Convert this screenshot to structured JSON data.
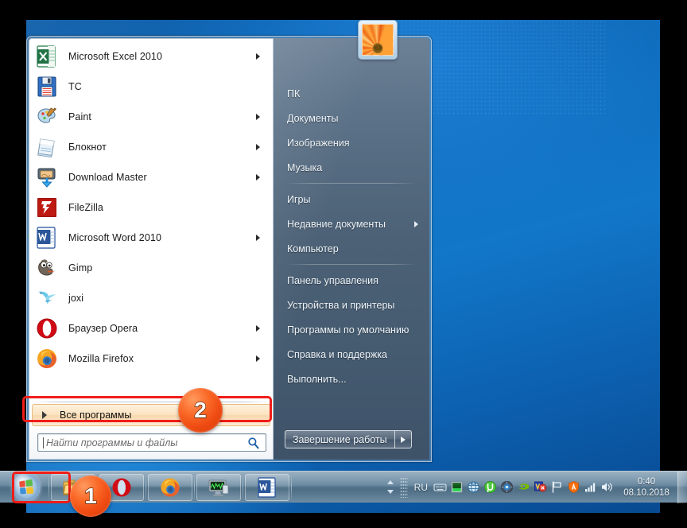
{
  "desktop": {
    "wallpaper_name": "windows-7-blue-wallpaper"
  },
  "start_menu": {
    "avatar_name": "user-avatar-flower",
    "programs": [
      {
        "label": "Microsoft Excel 2010",
        "icon": "excel-icon",
        "has_submenu": true
      },
      {
        "label": "TC",
        "icon": "total-commander-icon",
        "has_submenu": false
      },
      {
        "label": "Paint",
        "icon": "paint-icon",
        "has_submenu": true
      },
      {
        "label": "Блокнот",
        "icon": "notepad-icon",
        "has_submenu": true
      },
      {
        "label": "Download Master",
        "icon": "download-master-icon",
        "has_submenu": true
      },
      {
        "label": "FileZilla",
        "icon": "filezilla-icon",
        "has_submenu": false
      },
      {
        "label": "Microsoft Word 2010",
        "icon": "word-icon",
        "has_submenu": true
      },
      {
        "label": "Gimp",
        "icon": "gimp-icon",
        "has_submenu": false
      },
      {
        "label": "joxi",
        "icon": "joxi-icon",
        "has_submenu": false
      },
      {
        "label": "Браузер Opera",
        "icon": "opera-icon",
        "has_submenu": true
      },
      {
        "label": "Mozilla Firefox",
        "icon": "firefox-icon",
        "has_submenu": true
      }
    ],
    "all_programs": {
      "label": "Все программы",
      "icon": "chevron-right-icon"
    },
    "search": {
      "placeholder": "Найти программы и файлы",
      "value": "",
      "icon": "search-icon"
    },
    "right_items": [
      {
        "label": "ПК",
        "has_submenu": false,
        "separator_after": false
      },
      {
        "label": "Документы",
        "has_submenu": false,
        "separator_after": false
      },
      {
        "label": "Изображения",
        "has_submenu": false,
        "separator_after": false
      },
      {
        "label": "Музыка",
        "has_submenu": false,
        "separator_after": true
      },
      {
        "label": "Игры",
        "has_submenu": false,
        "separator_after": false
      },
      {
        "label": "Недавние документы",
        "has_submenu": true,
        "separator_after": false
      },
      {
        "label": "Компьютер",
        "has_submenu": false,
        "separator_after": true
      },
      {
        "label": "Панель управления",
        "has_submenu": false,
        "separator_after": false
      },
      {
        "label": "Устройства и принтеры",
        "has_submenu": false,
        "separator_after": false
      },
      {
        "label": "Программы по умолчанию",
        "has_submenu": false,
        "separator_after": false
      },
      {
        "label": "Справка и поддержка",
        "has_submenu": false,
        "separator_after": false
      },
      {
        "label": "Выполнить...",
        "has_submenu": false,
        "separator_after": false
      }
    ],
    "shutdown": {
      "label": "Завершение работы",
      "more_icon": "chevron-right-icon"
    }
  },
  "taskbar": {
    "start_button": {
      "name": "start-orb",
      "icon": "windows-logo-icon"
    },
    "pinned": [
      {
        "name": "explorer",
        "icon": "folder-icon"
      },
      {
        "name": "opera",
        "icon": "opera-icon"
      },
      {
        "name": "firefox",
        "icon": "firefox-icon"
      },
      {
        "name": "system-monitor",
        "icon": "monitor-icon"
      },
      {
        "name": "word",
        "icon": "word-icon"
      }
    ],
    "tray": {
      "language": "RU",
      "icons": [
        "keyboard-icon",
        "green-screen-icon",
        "blue-globe-icon",
        "utorrent-icon",
        "dark-globe-icon",
        "nvidia-icon",
        "app-icon",
        "flag-icon",
        "avast-icon",
        "signal-bars-icon",
        "volume-icon"
      ]
    },
    "clock": {
      "time": "0:40",
      "date": "08.10.2018"
    }
  },
  "annotations": {
    "badges": [
      {
        "number": "1",
        "target": "start-button",
        "color": "#f05a22"
      },
      {
        "number": "2",
        "target": "all-programs-button",
        "color": "#f05a22"
      }
    ],
    "highlight_color": "#f01d18"
  }
}
